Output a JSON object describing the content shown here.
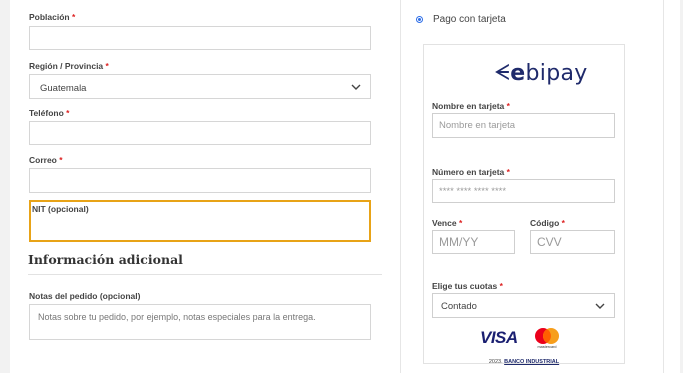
{
  "billing": {
    "poblacion": {
      "label": "Población",
      "required": "*",
      "value": ""
    },
    "region": {
      "label": "Región / Provincia",
      "required": "*",
      "selected": "Guatemala"
    },
    "telefono": {
      "label": "Teléfono",
      "required": "*",
      "value": ""
    },
    "correo": {
      "label": "Correo",
      "required": "*",
      "value": ""
    },
    "nit": {
      "label": "NIT (opcional)",
      "value": ""
    }
  },
  "additional": {
    "heading": "Información adicional",
    "notes_label": "Notas del pedido (opcional)",
    "notes_placeholder": "Notas sobre tu pedido, por ejemplo, notas especiales para la entrega."
  },
  "payment": {
    "method_label": "Pago con tarjeta",
    "logo": {
      "bold": "e",
      "text": "bipay",
      "mark": "ᗕ"
    },
    "card_name": {
      "label": "Nombre en tarjeta",
      "required": "*",
      "placeholder": "Nombre en tarjeta"
    },
    "card_number": {
      "label": "Número en tarjeta",
      "required": "*",
      "placeholder": "**** **** **** ****"
    },
    "expiry": {
      "label": "Vence",
      "required": "*",
      "placeholder": "MM/YY"
    },
    "cvv": {
      "label": "Código",
      "required": "*",
      "placeholder": "CVV"
    },
    "installments": {
      "label": "Elige tus cuotas",
      "required": "*",
      "selected": "Contado"
    },
    "brands": {
      "visa": "VISA",
      "mastercard": "mastercard"
    },
    "footer": {
      "year": "2023.",
      "bank": "BANCO INDUSTRIAL"
    }
  },
  "colors": {
    "focus_border": "#e8a317",
    "required": "#dd2222",
    "brand_navy": "#1f2a6b",
    "radio": "#2d6ee8"
  }
}
